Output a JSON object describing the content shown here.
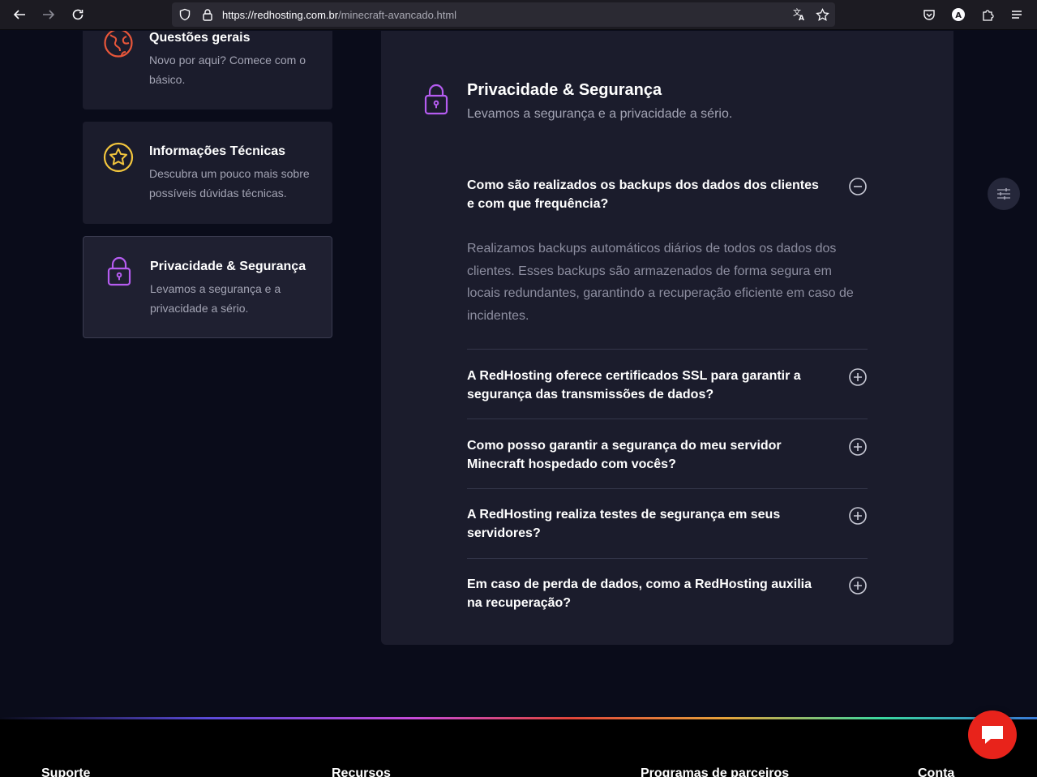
{
  "browser": {
    "url_host": "https://redhosting.com.br",
    "url_path": "/minecraft-avancado.html"
  },
  "sidebar": {
    "items": [
      {
        "title": "Questões gerais",
        "description": "Novo por aqui? Comece com o básico.",
        "icon": "globe-icon",
        "color": "#e8563a"
      },
      {
        "title": "Informações Técnicas",
        "description": "Descubra um pouco mais sobre possíveis dúvidas técnicas.",
        "icon": "star-icon",
        "color": "#f2c53d"
      },
      {
        "title": "Privacidade & Segurança",
        "description": "Levamos a segurança e a privacidade a sério.",
        "icon": "lock-icon",
        "color": "#b55cf0",
        "active": true
      }
    ]
  },
  "panel": {
    "title": "Privacidade & Segurança",
    "subtitle": "Levamos a segurança e a privacidade a sério.",
    "faqs": [
      {
        "question": "Como são realizados os backups dos dados dos clientes e com que frequência?",
        "answer": "Realizamos backups automáticos diários de todos os dados dos clientes. Esses backups são armazenados de forma segura em locais redundantes, garantindo a recuperação eficiente em caso de incidentes.",
        "expanded": true
      },
      {
        "question": "A RedHosting oferece certificados SSL para garantir a segurança das transmissões de dados?",
        "expanded": false
      },
      {
        "question": "Como posso garantir a segurança do meu servidor Minecraft hospedado com vocês?",
        "expanded": false
      },
      {
        "question": "A RedHosting realiza testes de segurança em seus servidores?",
        "expanded": false
      },
      {
        "question": "Em caso de perda de dados, como a RedHosting auxilia na recuperação?",
        "expanded": false
      }
    ]
  },
  "footer": {
    "columns": [
      "Suporte",
      "Recursos",
      "Programas de parceiros",
      "Conta"
    ]
  },
  "colors": {
    "accent_purple": "#b55cf0",
    "chat_red": "#e8231b"
  }
}
